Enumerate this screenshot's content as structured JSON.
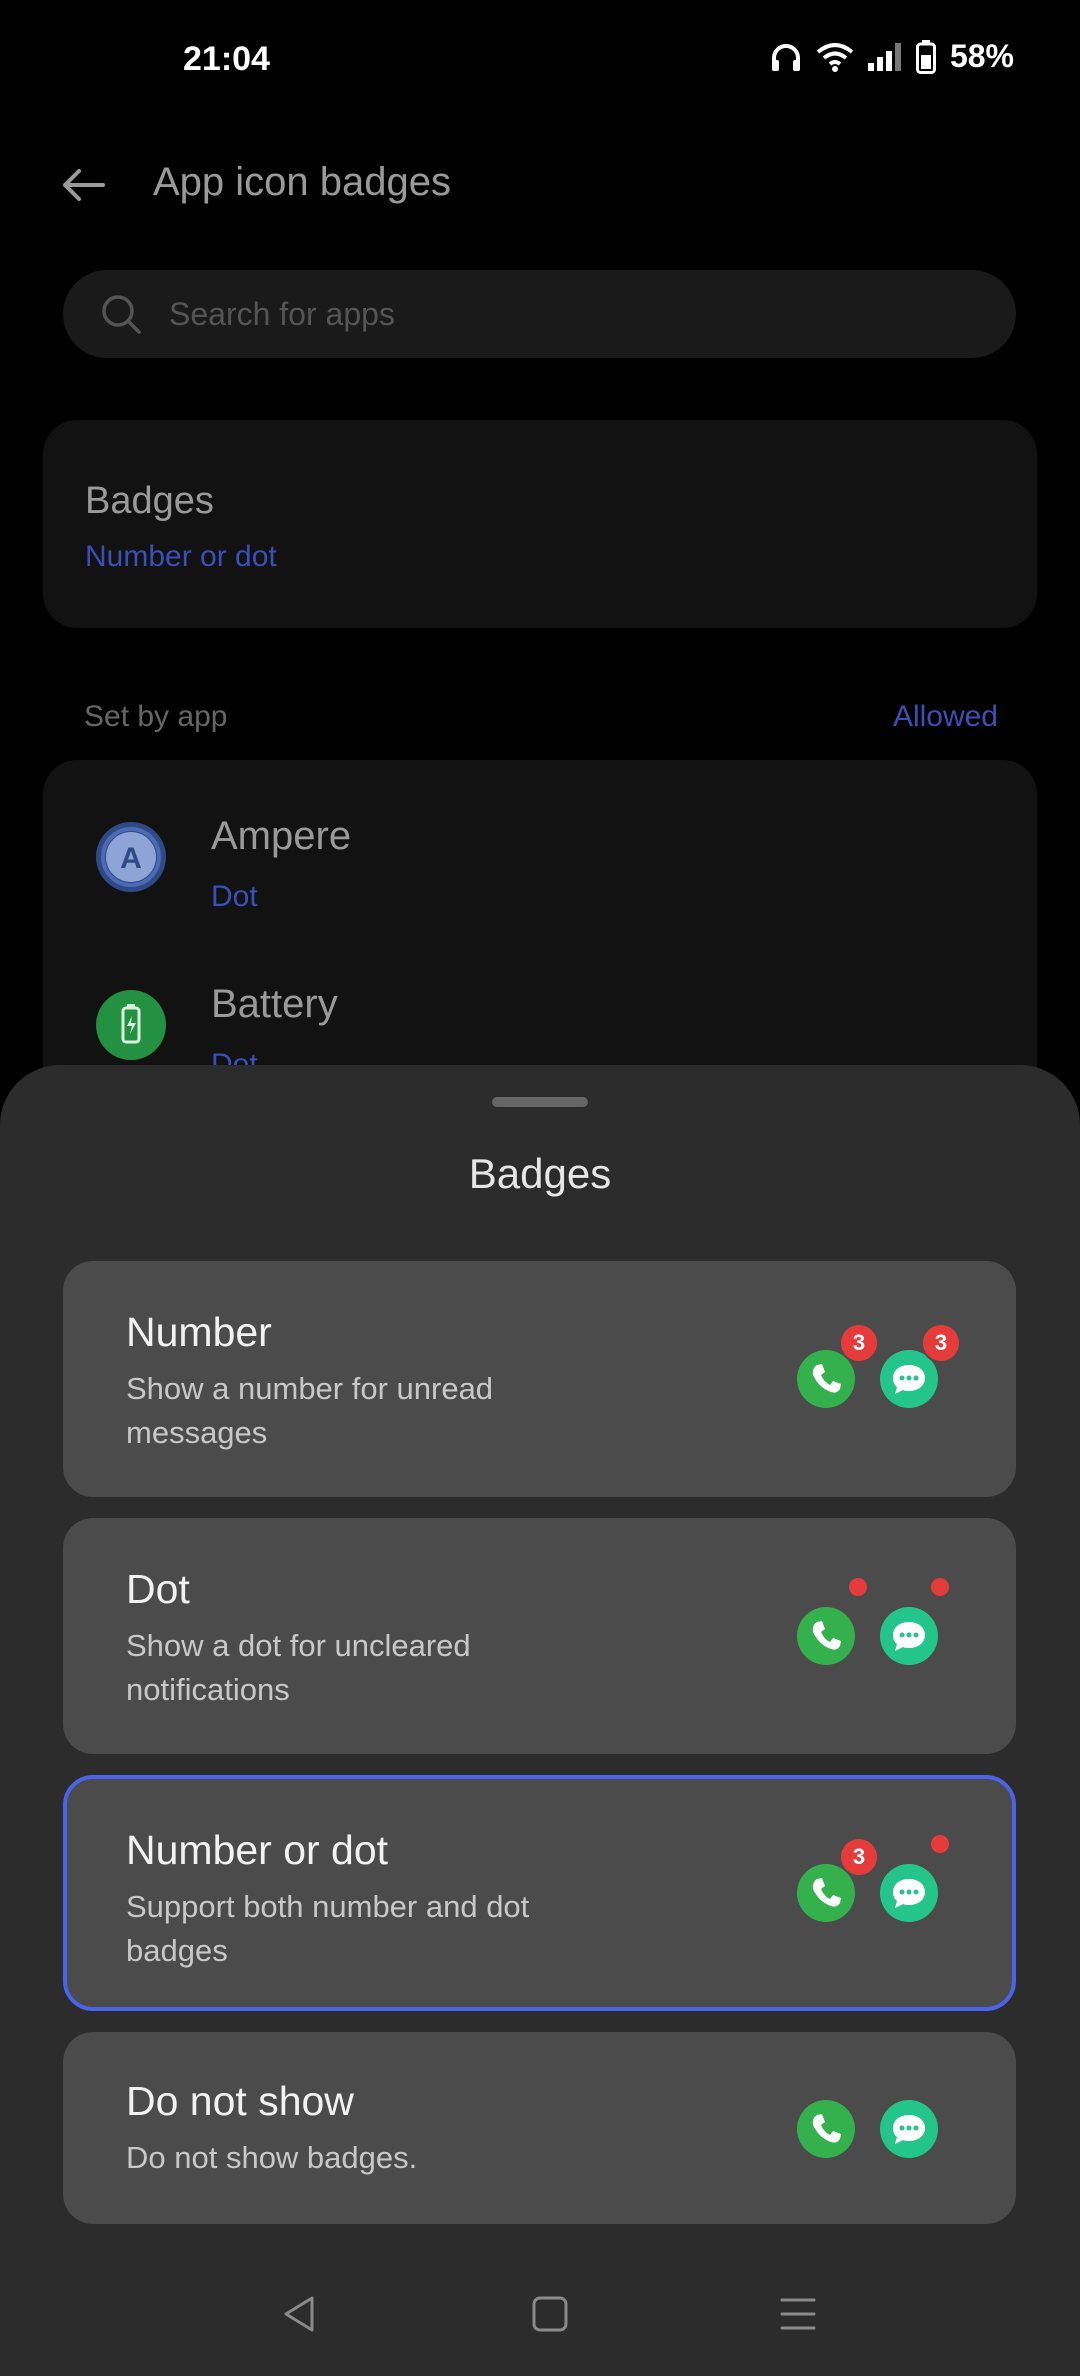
{
  "status_bar": {
    "time": "21:04",
    "battery": "58%"
  },
  "header": {
    "title": "App icon badges",
    "back_icon": "arrow-left-icon"
  },
  "search": {
    "placeholder": "Search for apps"
  },
  "badges_setting": {
    "title": "Badges",
    "value": "Number or dot"
  },
  "set_by_app": {
    "label": "Set by app",
    "filter": "Allowed"
  },
  "apps": [
    {
      "name": "Ampere",
      "badge": "Dot",
      "icon": "ampere-icon"
    },
    {
      "name": "Battery",
      "badge": "Dot",
      "icon": "battery-app-icon"
    }
  ],
  "sheet": {
    "title": "Badges",
    "options": [
      {
        "title": "Number",
        "desc": "Show a number for unread messages",
        "selected": false,
        "badge_count": "3"
      },
      {
        "title": "Dot",
        "desc": "Show a dot for uncleared notifications",
        "selected": false
      },
      {
        "title": "Number or dot",
        "desc": "Support both number and dot badges",
        "selected": true,
        "badge_count": "3"
      },
      {
        "title": "Do not show",
        "desc": "Do not show badges.",
        "selected": false
      }
    ]
  },
  "colors": {
    "accent": "#4a63e8",
    "link": "#3b4fb8",
    "badge": "#e53b3b",
    "phone": "#34b04c",
    "message": "#23c58c"
  }
}
